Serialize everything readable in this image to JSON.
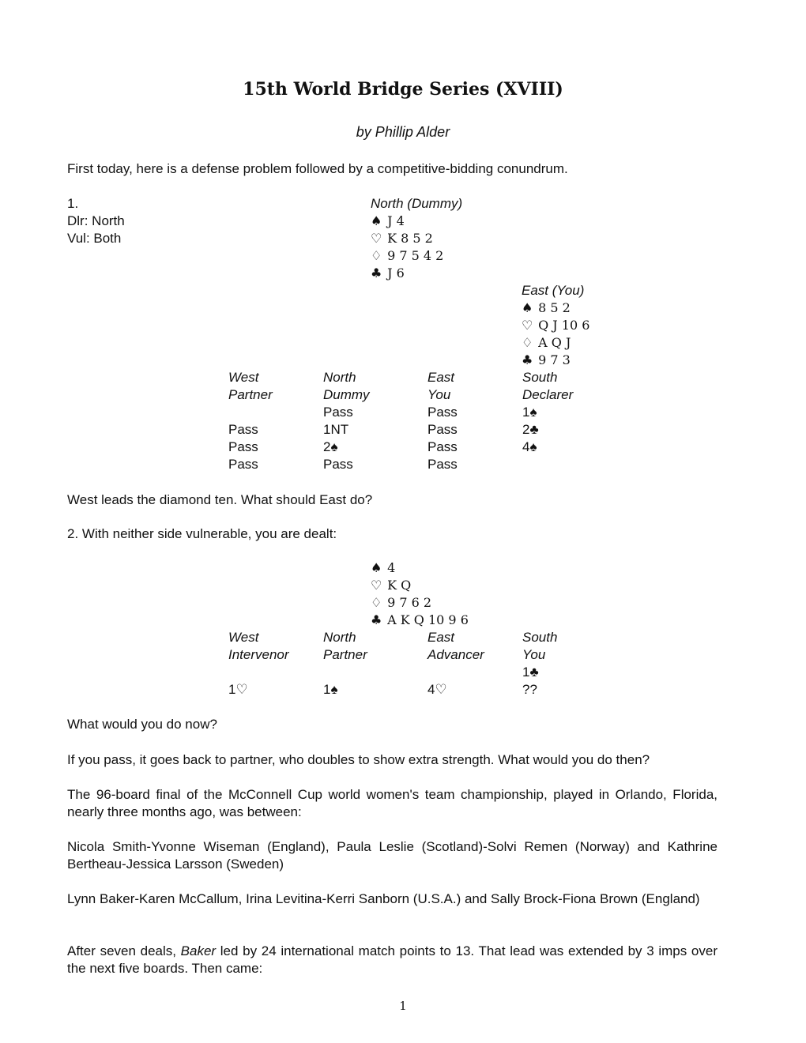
{
  "title": "15th World Bridge Series (XVIII)",
  "byline": "by Phillip Alder",
  "intro": "First today, here is a defense problem followed by a competitive-bidding conundrum.",
  "problem1": {
    "number": "1.",
    "dealer": "Dlr: North",
    "vul": "Vul: Both",
    "north": {
      "label": "North (Dummy)",
      "spades": "J 4",
      "hearts": "K 8 5 2",
      "diamonds": "9 7 5 4 2",
      "clubs": "J 6"
    },
    "east": {
      "label": "East (You)",
      "spades": "8 5 2",
      "hearts": "Q J 10 6",
      "diamonds": "A Q J",
      "clubs": "9 7 3"
    },
    "auction": {
      "headers": [
        "West",
        "North",
        "East",
        "South"
      ],
      "roles": [
        "Partner",
        "Dummy",
        "You",
        "Declarer"
      ],
      "rows": [
        [
          "",
          "Pass",
          "Pass",
          "1♠"
        ],
        [
          "Pass",
          "1NT",
          "Pass",
          "2♣"
        ],
        [
          "Pass",
          "2♠",
          "Pass",
          "4♠"
        ],
        [
          "Pass",
          "Pass",
          "Pass",
          ""
        ]
      ]
    },
    "question": "West leads the diamond ten. What should East do?"
  },
  "problem2": {
    "intro": "2. With neither side vulnerable, you are dealt:",
    "hand": {
      "spades": "4",
      "hearts": "K Q",
      "diamonds": "9 7 6 2",
      "clubs": "A K Q 10 9 6"
    },
    "auction": {
      "headers": [
        "West",
        "North",
        "East",
        "South"
      ],
      "roles": [
        "Intervenor",
        "Partner",
        "Advancer",
        "You"
      ],
      "rows": [
        [
          "",
          "",
          "",
          "1♣"
        ],
        [
          "1♡",
          "1♠",
          "4♡",
          "??"
        ]
      ]
    },
    "question1": "What would you do now?",
    "question2": "If you pass, it goes back to partner, who doubles to show extra strength. What would you do then?"
  },
  "suits": {
    "spades": "♠",
    "hearts": "♡",
    "diamonds": "♢",
    "clubs": "♣"
  },
  "body": {
    "p1": "The 96-board final of the McConnell Cup world women's team championship, played in Orlando, Florida, nearly three months ago, was between:",
    "p2": "Nicola Smith-Yvonne Wiseman (England), Paula Leslie (Scotland)-Solvi Remen (Norway) and Kathrine Bertheau-Jessica Larsson (Sweden)",
    "p3": "Lynn Baker-Karen McCallum, Irina Levitina-Kerri Sanborn (U.S.A.) and Sally Brock-Fiona Brown (England)",
    "p4_before": "After seven deals, ",
    "p4_italic": "Baker",
    "p4_after": " led by 24 international match points to 13. That lead was extended by 3 imps over the next five boards. Then came:"
  },
  "page_number": "1"
}
